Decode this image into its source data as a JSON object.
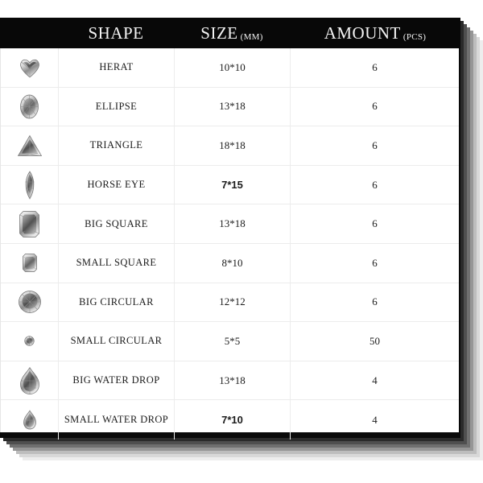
{
  "table": {
    "columns": [
      {
        "key": "image",
        "label": "",
        "unit": ""
      },
      {
        "key": "shape",
        "label": "SHAPE",
        "unit": ""
      },
      {
        "key": "size",
        "label": "SIZE",
        "unit": "(MM)"
      },
      {
        "key": "amount",
        "label": "AMOUNT",
        "unit": "(PCS)"
      }
    ],
    "header_background": "#080808",
    "header_text_color": "#f4f4f4",
    "rows": [
      {
        "icon": "heart-gem-icon",
        "shape": "HERAT",
        "size": "10*10",
        "amount": "6",
        "size_style": "serif"
      },
      {
        "icon": "ellipse-gem-icon",
        "shape": "ELLIPSE",
        "size": "13*18",
        "amount": "6",
        "size_style": "serif"
      },
      {
        "icon": "triangle-gem-icon",
        "shape": "TRIANGLE",
        "size": "18*18",
        "amount": "6",
        "size_style": "serif"
      },
      {
        "icon": "marquise-gem-icon",
        "shape": "HORSE EYE",
        "size": "7*15",
        "amount": "6",
        "size_style": "sans"
      },
      {
        "icon": "big-square-gem-icon",
        "shape": "BIG SQUARE",
        "size": "13*18",
        "amount": "6",
        "size_style": "serif"
      },
      {
        "icon": "small-square-gem-icon",
        "shape": "SMALL SQUARE",
        "size": "8*10",
        "amount": "6",
        "size_style": "serif"
      },
      {
        "icon": "big-round-gem-icon",
        "shape": "BIG CIRCULAR",
        "size": "12*12",
        "amount": "6",
        "size_style": "serif"
      },
      {
        "icon": "small-round-gem-icon",
        "shape": "SMALL CIRCULAR",
        "size": "5*5",
        "amount": "50",
        "size_style": "serif"
      },
      {
        "icon": "big-teardrop-gem-icon",
        "shape": "BIG WATER DROP",
        "size": "13*18",
        "amount": "4",
        "size_style": "serif"
      },
      {
        "icon": "small-teardrop-gem-icon",
        "shape": "SMALL WATER DROP",
        "size": "7*10",
        "amount": "4",
        "size_style": "sans"
      }
    ]
  },
  "style": {
    "page_background": "#ffffff",
    "frame_color": "#0a0a0a",
    "grid_line_color": "#ececec",
    "shadow_steps": [
      "#2a2a2a",
      "#4f4f4f",
      "#6f6f6f",
      "#969696",
      "#bdbdbd",
      "#d8d8d8",
      "#ededed"
    ]
  }
}
